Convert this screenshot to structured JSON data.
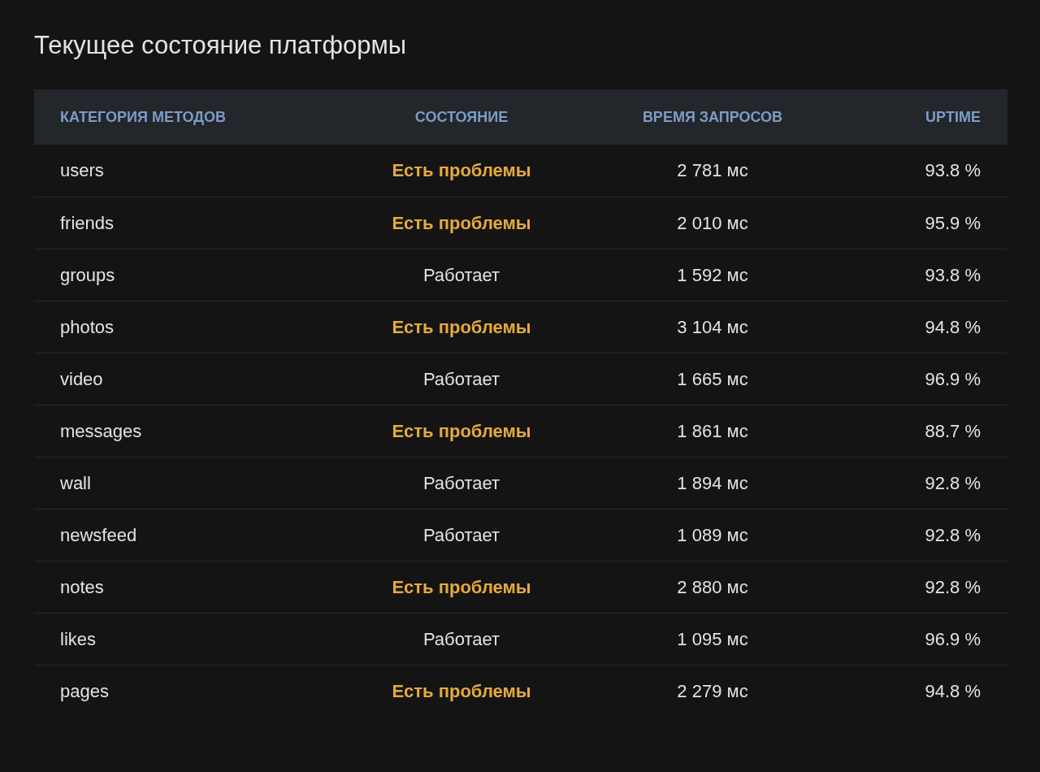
{
  "title": "Текущее состояние платформы",
  "table": {
    "columns": [
      "КАТЕГОРИЯ МЕТОДОВ",
      "СОСТОЯНИЕ",
      "ВРЕМЯ ЗАПРОСОВ",
      "UPTIME"
    ],
    "rows": [
      {
        "category": "users",
        "status": "Есть проблемы",
        "kind": "problem",
        "time": "2 781 мс",
        "uptime": "93.8 %"
      },
      {
        "category": "friends",
        "status": "Есть проблемы",
        "kind": "problem",
        "time": "2 010 мс",
        "uptime": "95.9 %"
      },
      {
        "category": "groups",
        "status": "Работает",
        "kind": "ok",
        "time": "1 592 мс",
        "uptime": "93.8 %"
      },
      {
        "category": "photos",
        "status": "Есть проблемы",
        "kind": "problem",
        "time": "3 104 мс",
        "uptime": "94.8 %"
      },
      {
        "category": "video",
        "status": "Работает",
        "kind": "ok",
        "time": "1 665 мс",
        "uptime": "96.9 %"
      },
      {
        "category": "messages",
        "status": "Есть проблемы",
        "kind": "problem",
        "time": "1 861 мс",
        "uptime": "88.7 %"
      },
      {
        "category": "wall",
        "status": "Работает",
        "kind": "ok",
        "time": "1 894 мс",
        "uptime": "92.8 %"
      },
      {
        "category": "newsfeed",
        "status": "Работает",
        "kind": "ok",
        "time": "1 089 мс",
        "uptime": "92.8 %"
      },
      {
        "category": "notes",
        "status": "Есть проблемы",
        "kind": "problem",
        "time": "2 880 мс",
        "uptime": "92.8 %"
      },
      {
        "category": "likes",
        "status": "Работает",
        "kind": "ok",
        "time": "1 095 мс",
        "uptime": "96.9 %"
      },
      {
        "category": "pages",
        "status": "Есть проблемы",
        "kind": "problem",
        "time": "2 279 мс",
        "uptime": "94.8 %"
      }
    ]
  }
}
